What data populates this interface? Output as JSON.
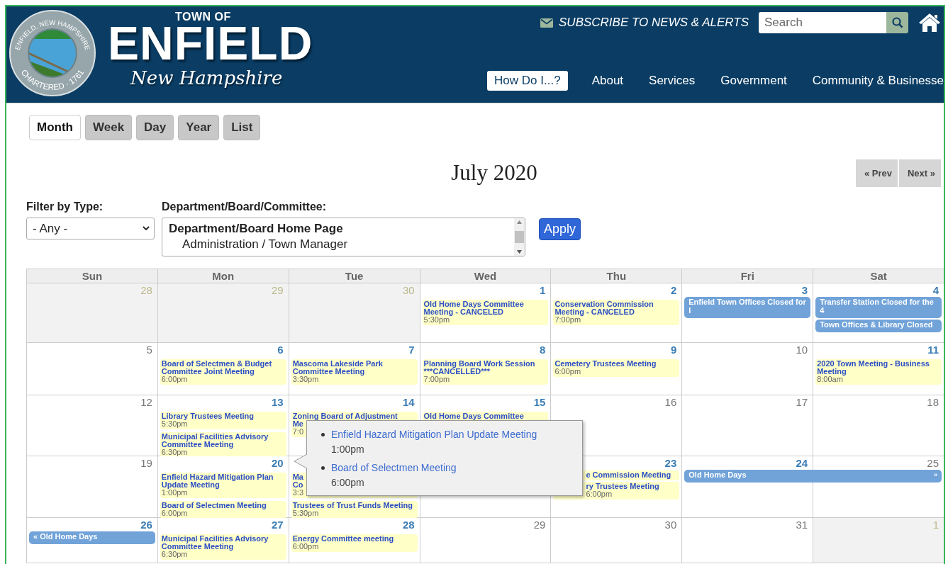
{
  "header": {
    "seal": {
      "top_text": "ENFIELD, NEW HAMPSHIRE",
      "bottom_text": "CHARTERED · 1761"
    },
    "town_of": "TOWN OF",
    "name": "ENFIELD",
    "state": "New Hampshire",
    "subscribe": "SUBSCRIBE TO NEWS & ALERTS",
    "search": {
      "placeholder": "Search"
    },
    "nav": [
      {
        "label": "How Do I...?",
        "kind": "button"
      },
      {
        "label": "About",
        "kind": "link"
      },
      {
        "label": "Services",
        "kind": "link"
      },
      {
        "label": "Government",
        "kind": "link"
      },
      {
        "label": "Community & Businesse",
        "kind": "link"
      }
    ]
  },
  "view_tabs": [
    {
      "label": "Month",
      "selected": true
    },
    {
      "label": "Week",
      "selected": false
    },
    {
      "label": "Day",
      "selected": false
    },
    {
      "label": "Year",
      "selected": false
    },
    {
      "label": "List",
      "selected": false
    }
  ],
  "title": "July 2020",
  "pager": {
    "prev": "« Prev",
    "next": "Next »"
  },
  "filters": {
    "type": {
      "label": "Filter by Type:",
      "value": "- Any -"
    },
    "department": {
      "label": "Department/Board/Committee:",
      "options": [
        {
          "label": "Department/Board Home Page",
          "kind": "group"
        },
        {
          "label": "Administration / Town Manager",
          "kind": "option"
        }
      ]
    },
    "apply": "Apply"
  },
  "calendar": {
    "weekdays": [
      "Sun",
      "Mon",
      "Tue",
      "Wed",
      "Thu",
      "Fri",
      "Sat"
    ],
    "weeks": [
      {
        "days": [
          {
            "date": "28",
            "other_month": true
          },
          {
            "date": "29",
            "other_month": true
          },
          {
            "date": "30",
            "other_month": true
          },
          {
            "date": "1",
            "other_month": false,
            "events": [
              {
                "kind": "timed",
                "title": "Old Home Days Committee Meeting - CANCELED",
                "time": "5:30pm"
              }
            ]
          },
          {
            "date": "2",
            "other_month": false,
            "events": [
              {
                "kind": "timed",
                "title": "Conservation Commission Meeting - CANCELED",
                "time": "7:00pm"
              }
            ]
          },
          {
            "date": "3",
            "other_month": false,
            "events": [
              {
                "kind": "all_day",
                "title": "Enfield Town Offices Closed for I"
              }
            ]
          },
          {
            "date": "4",
            "other_month": false,
            "events": [
              {
                "kind": "all_day",
                "title": "Transfer Station Closed for the 4"
              },
              {
                "kind": "all_day",
                "title": "Town Offices & Library Closed"
              }
            ]
          }
        ]
      },
      {
        "days": [
          {
            "date": "5",
            "other_month": false
          },
          {
            "date": "6",
            "other_month": false,
            "events": [
              {
                "kind": "timed",
                "title": "Board of Selectmen & Budget Committee Joint Meeting",
                "time": "6:00pm"
              }
            ]
          },
          {
            "date": "7",
            "other_month": false,
            "events": [
              {
                "kind": "timed",
                "title": "Mascoma Lakeside Park Committee Meeting",
                "time": "3:30pm"
              }
            ]
          },
          {
            "date": "8",
            "other_month": false,
            "events": [
              {
                "kind": "timed",
                "title": "Planning Board Work Session ***CANCELLED***",
                "time": "7:00pm"
              }
            ]
          },
          {
            "date": "9",
            "other_month": false,
            "events": [
              {
                "kind": "timed",
                "title": "Cemetery Trustees Meeting",
                "time": "6:00pm"
              }
            ]
          },
          {
            "date": "10",
            "other_month": false
          },
          {
            "date": "11",
            "other_month": false,
            "events": [
              {
                "kind": "timed",
                "title": "2020 Town Meeting - Business Meeting",
                "time": "8:00am"
              }
            ]
          }
        ]
      },
      {
        "days": [
          {
            "date": "12",
            "other_month": false
          },
          {
            "date": "13",
            "other_month": false,
            "events": [
              {
                "kind": "timed",
                "title": "Library Trustees Meeting",
                "time": "5:30pm"
              },
              {
                "kind": "timed",
                "title": "Municipal Facilities Advisory Committee Meeting",
                "time": "6:30pm"
              }
            ]
          },
          {
            "date": "14",
            "other_month": false,
            "events": [
              {
                "kind": "timed",
                "title": "Zoning Board of Adjustment\nMe",
                "time": "7:0"
              }
            ]
          },
          {
            "date": "15",
            "other_month": false,
            "events": [
              {
                "kind": "timed",
                "title": "Old Home Days Committee"
              }
            ]
          },
          {
            "date": "16",
            "other_month": false
          },
          {
            "date": "17",
            "other_month": false
          },
          {
            "date": "18",
            "other_month": false
          }
        ]
      },
      {
        "days": [
          {
            "date": "19",
            "other_month": false
          },
          {
            "date": "20",
            "other_month": false,
            "events": [
              {
                "kind": "timed",
                "title": "Enfield Hazard Mitigation Plan Update Meeting",
                "time": "1:00pm"
              },
              {
                "kind": "timed",
                "title": "Board of Selectmen Meeting",
                "time": "6:00pm"
              }
            ]
          },
          {
            "other_month": false,
            "events": [
              {
                "kind": "timed",
                "title": "Ma\nCo",
                "time": "3:3"
              },
              {
                "kind": "timed",
                "title": "Trustees of Trust Funds Meeting",
                "time": "5:30pm"
              }
            ]
          },
          {
            "other_month": false
          },
          {
            "date": "23",
            "other_month": false,
            "events": [
              {
                "kind": "timed_covered_start",
                "title": "e Commission Meeting"
              },
              {
                "kind": "timed_covered_start",
                "title": "ry Trustees Meeting",
                "time": "6:00pm"
              }
            ]
          },
          {
            "date": "24",
            "other_month": false,
            "events": [
              {
                "kind": "multi_day",
                "title": "Old Home Days",
                "end_mark": "»"
              }
            ]
          },
          {
            "date": "25",
            "other_month": false
          }
        ]
      },
      {
        "days": [
          {
            "date": "26",
            "other_month": false,
            "events": [
              {
                "kind": "all_day",
                "title": "« Old Home Days"
              }
            ]
          },
          {
            "date": "27",
            "other_month": false,
            "events": [
              {
                "kind": "timed",
                "title": "Municipal Facilities Advisory Committee Meeting",
                "time": "6:30pm"
              }
            ]
          },
          {
            "date": "28",
            "other_month": false,
            "events": [
              {
                "kind": "timed",
                "title": "Energy Committee meeting",
                "time": "6:00pm"
              }
            ]
          },
          {
            "date": "29",
            "other_month": false
          },
          {
            "date": "30",
            "other_month": false
          },
          {
            "date": "31",
            "other_month": false
          },
          {
            "date": "1",
            "other_month": true
          }
        ]
      }
    ]
  },
  "popup": {
    "items": [
      {
        "title": "Enfield Hazard Mitigation Plan Update Meeting",
        "time": "1:00pm"
      },
      {
        "title": "Board of Selectmen Meeting",
        "time": "6:00pm"
      }
    ]
  }
}
